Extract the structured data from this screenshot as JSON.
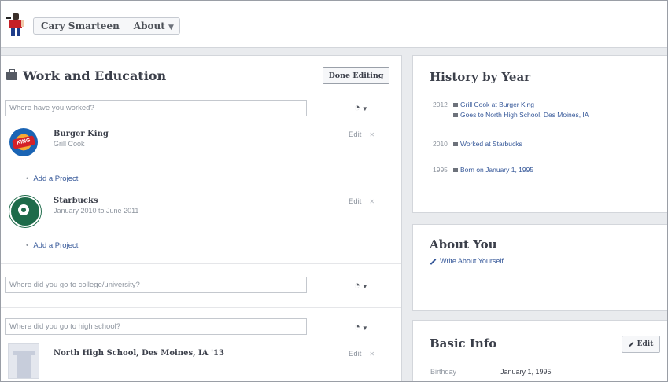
{
  "header": {
    "name": "Cary Smarteen",
    "about_label": "About",
    "caret": "▼"
  },
  "work_education": {
    "title": "Work and Education",
    "done_label": "Done Editing",
    "work_placeholder": "Where have you worked?",
    "privacy_icon": "globe-icon",
    "jobs": [
      {
        "employer": "Burger King",
        "detail": "Grill Cook",
        "edit": "Edit",
        "add_project": "Add a Project"
      },
      {
        "employer": "Starbucks",
        "detail": "January 2010 to June 2011",
        "edit": "Edit",
        "add_project": "Add a Project"
      }
    ],
    "college_placeholder": "Where did you go to college/university?",
    "highschool_placeholder": "Where did you go to high school?",
    "school": {
      "name": "North High School, Des Moines, IA '13",
      "edit": "Edit"
    }
  },
  "history": {
    "title": "History by Year",
    "rows": [
      {
        "year": "2012",
        "items": [
          "Grill Cook at Burger King",
          "Goes to North High School, Des Moines, IA"
        ]
      },
      {
        "year": "2010",
        "items": [
          "Worked at Starbucks"
        ]
      },
      {
        "year": "1995",
        "items": [
          "Born on January 1, 1995"
        ]
      }
    ]
  },
  "about": {
    "title": "About You",
    "write_label": "Write About Yourself"
  },
  "basic_info": {
    "title": "Basic Info",
    "edit_label": "Edit",
    "birthday_label": "Birthday",
    "birthday_value": "January 1, 1995"
  },
  "colors": {
    "link": "#365899",
    "muted": "#8d949e",
    "bg": "#e9ebee"
  }
}
